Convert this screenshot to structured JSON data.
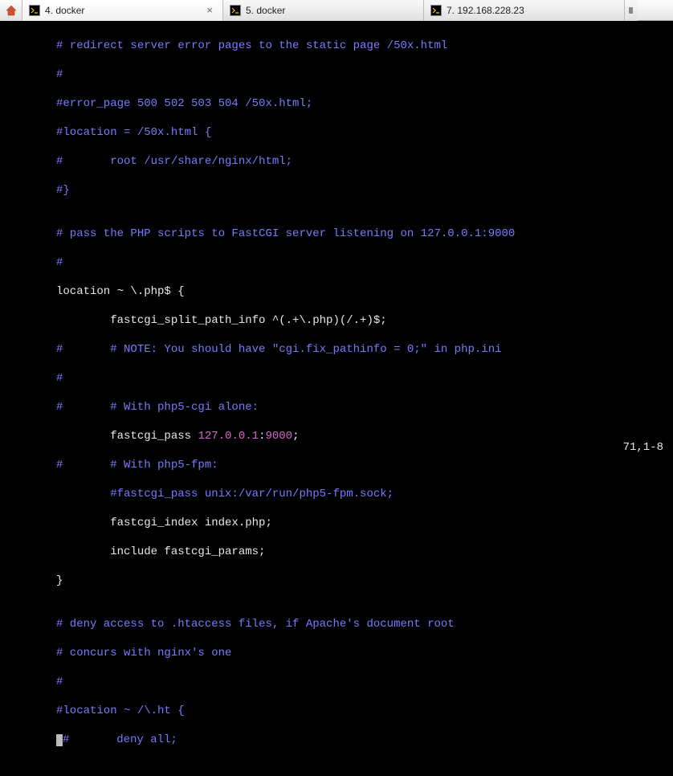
{
  "tabs": [
    {
      "label": "4. docker",
      "active": true
    },
    {
      "label": "5. docker",
      "active": false
    },
    {
      "label": "7. 192.168.228.23",
      "active": false
    }
  ],
  "code": {
    "l1": "# redirect server error pages to the static page /50x.html",
    "l2": "#",
    "l3": "#error_page 500 502 503 504 /50x.html;",
    "l4": "#location = /50x.html {",
    "l5": "#       root /usr/share/nginx/html;",
    "l6": "#}",
    "l7": "",
    "l8": "# pass the PHP scripts to FastCGI server listening on 127.0.0.1:9000",
    "l9": "#",
    "l10a": "location ~ \\.php$ {",
    "l11": "        fastcgi_split_path_info ^(.+\\.php)(/.+)$;",
    "l12": "#       # NOTE: You should have \"cgi.fix_pathinfo = 0;\" in php.ini",
    "l13": "#",
    "l14": "#       # With php5-cgi alone:",
    "l15a": "        fastcgi_pass ",
    "l15b": "127.0.0.1",
    "l15c": ":",
    "l15d": "9000",
    "l15e": ";",
    "l16": "#       # With php5-fpm:",
    "l17": "        #fastcgi_pass unix:/var/run/php5-fpm.sock;",
    "l18": "        fastcgi_index index.php;",
    "l19": "        include fastcgi_params;",
    "l20": "}",
    "l21": "",
    "l22": "# deny access to .htaccess files, if Apache's document root",
    "l23": "# concurs with nginx's one",
    "l24": "#",
    "l25": "#location ~ /\\.ht {",
    "l26": "#       deny all;"
  },
  "status": "71,1-8"
}
